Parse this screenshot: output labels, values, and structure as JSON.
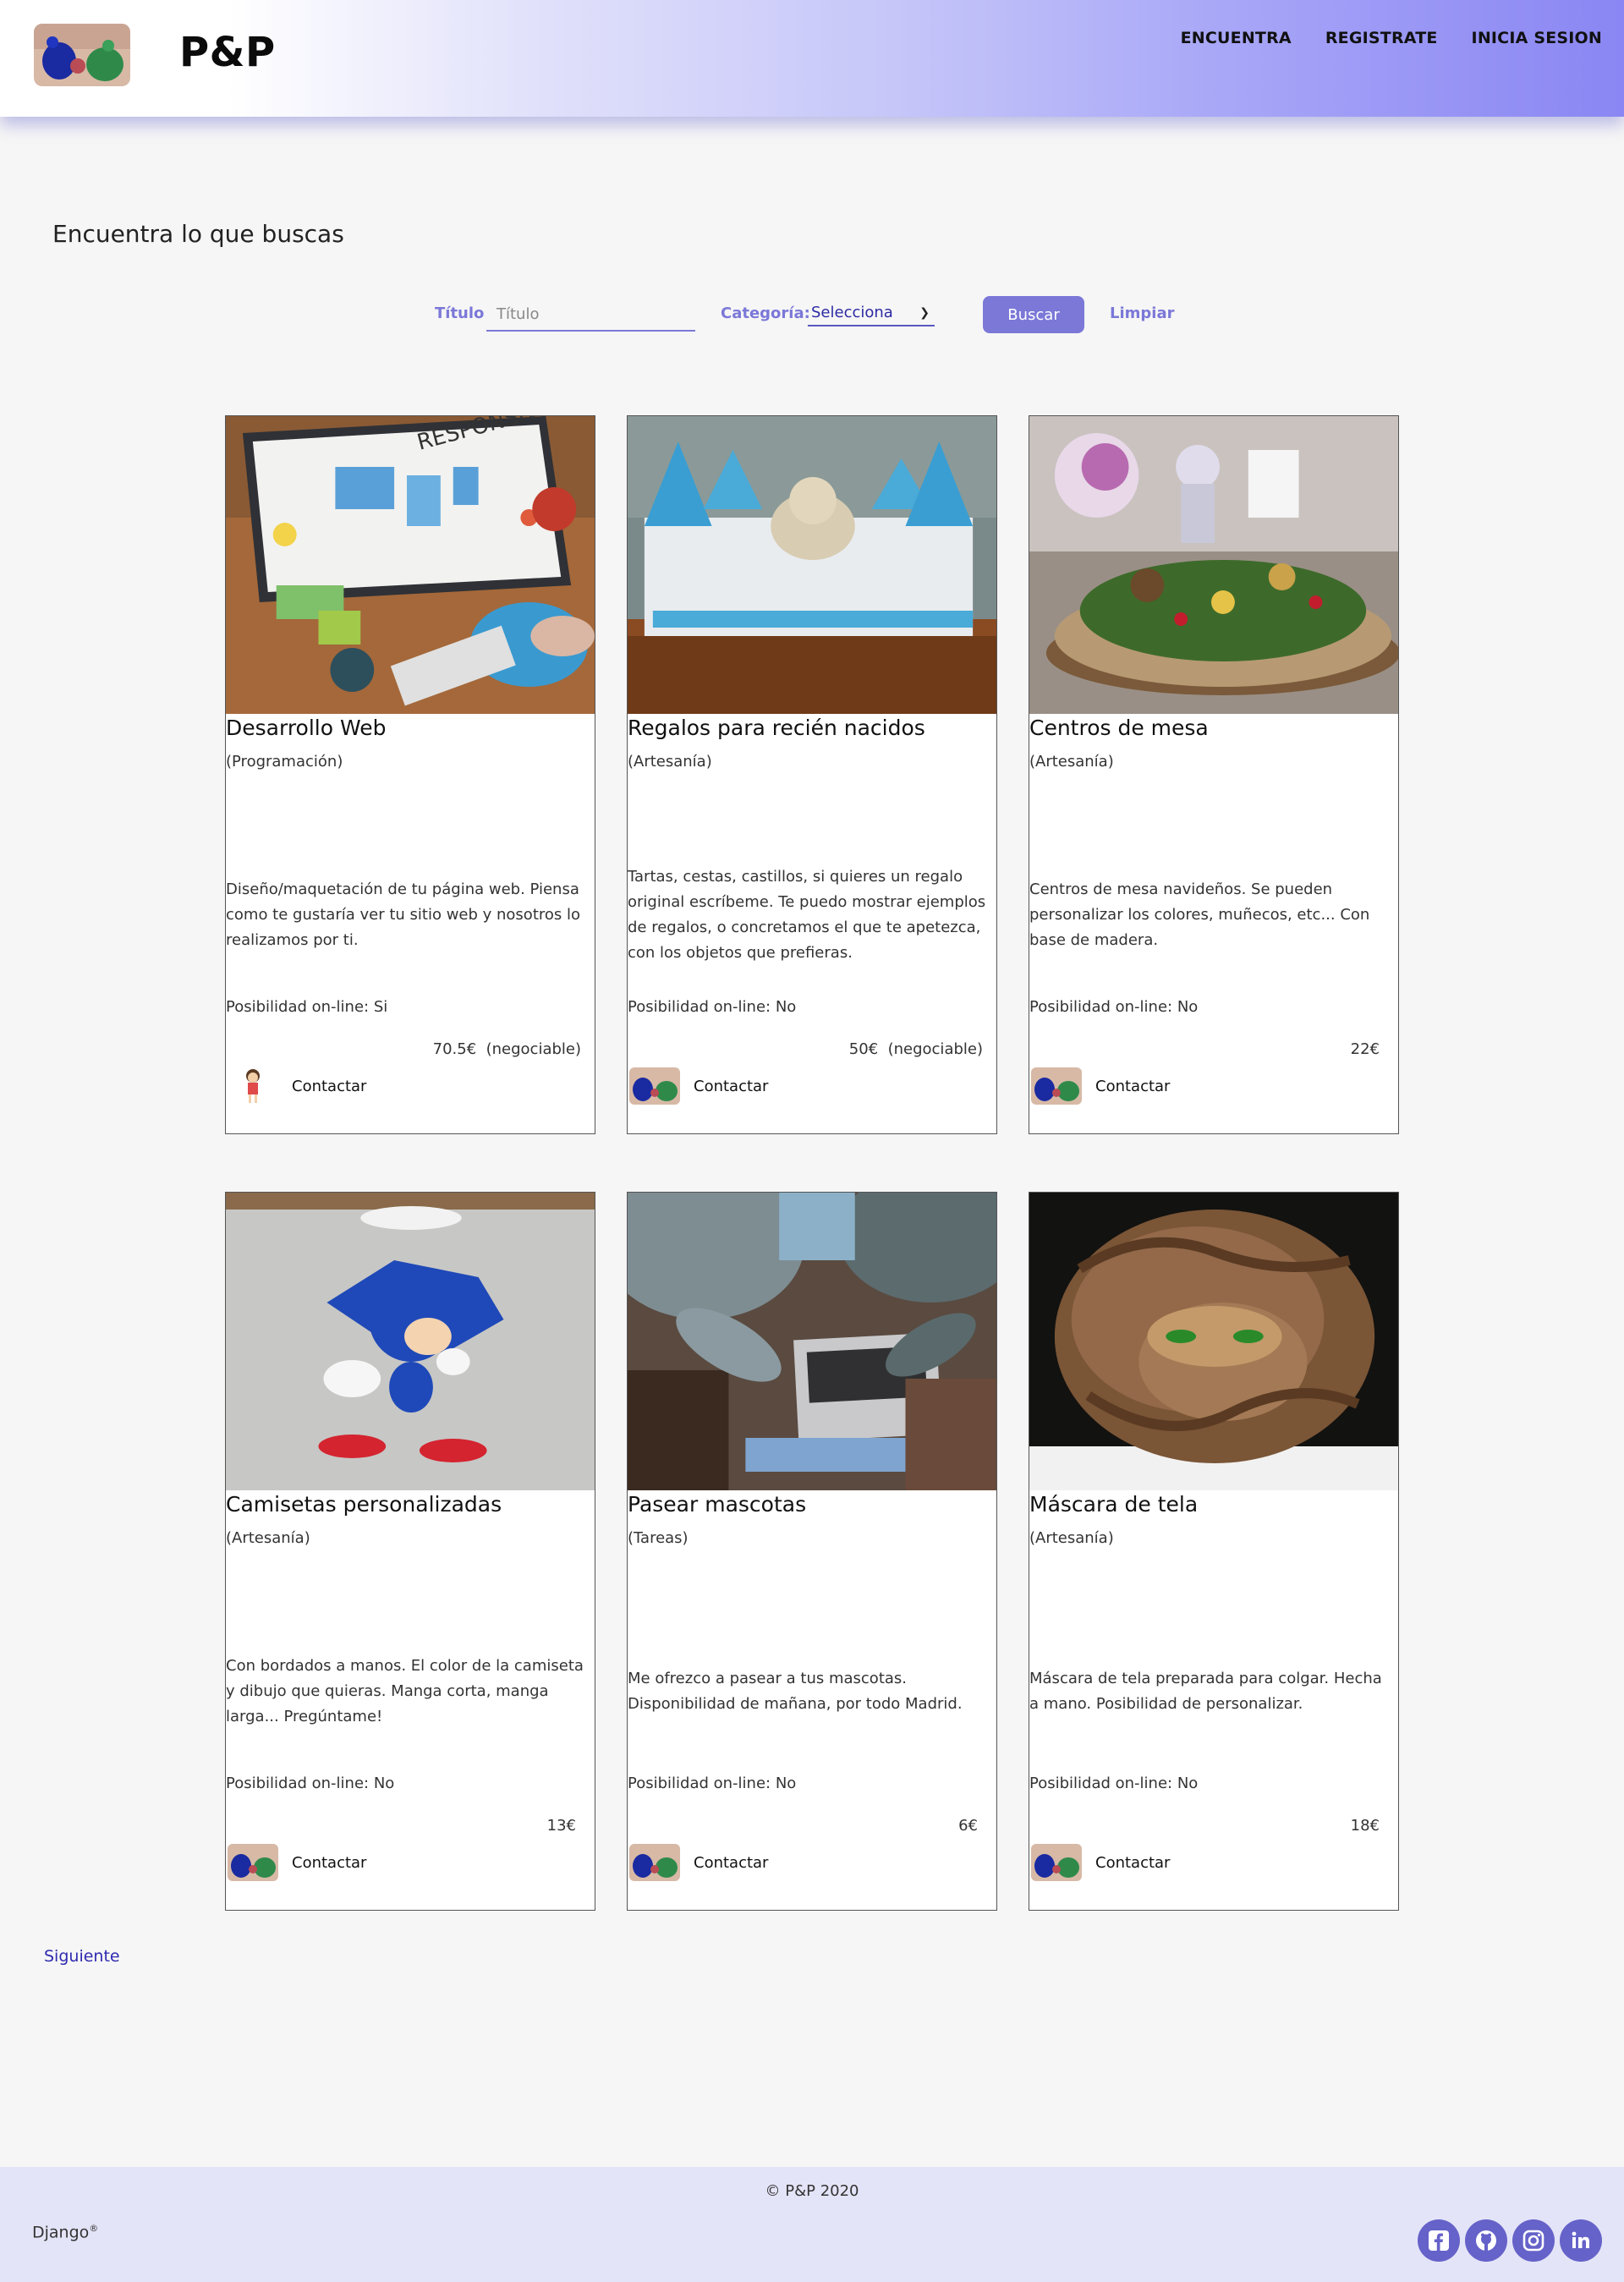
{
  "header": {
    "logo_alt": "P&P logo",
    "brand": "P&P",
    "nav": [
      "ENCUENTRA",
      "REGISTRATE",
      "INICIA SESION"
    ]
  },
  "page_title": "Encuentra lo que buscas",
  "filters": {
    "title_label": "Título",
    "title_placeholder": "Título",
    "category_label": "Categoría:",
    "category_selected": "Selecciona",
    "search_button": "Buscar",
    "clear_link": "Limpiar"
  },
  "cards": [
    {
      "title": "Desarrollo Web",
      "category": "(Programación)",
      "description": "Diseño/maquetación de tu página web. Piensa como te gustaría ver tu sitio web y nosotros lo realizamos por ti.",
      "online": "Posibilidad on-line: Si",
      "price": "70.5€  (negociable)",
      "contact": "Contactar",
      "image_icon": "responsive-design-desk-image",
      "avatar_icon": "girl-avatar-icon"
    },
    {
      "title": "Regalos para recién nacidos",
      "category": "(Artesanía)",
      "description": "Tartas, cestas, castillos, si quieres un regalo original escríbeme. Te puedo mostrar ejemplos de regalos, o concretamos el que te apetezca, con los objetos que prefieras.",
      "online": "Posibilidad on-line: No",
      "price": "50€  (negociable)",
      "contact": "Contactar",
      "image_icon": "diaper-castle-image",
      "avatar_icon": "dolls-avatar-icon"
    },
    {
      "title": "Centros de mesa",
      "category": "(Artesanía)",
      "description": "Centros de mesa navideños. Se pueden personalizar los colores, muñecos, etc... Con base de madera.",
      "online": "Posibilidad on-line: No",
      "price": "22€",
      "contact": "Contactar",
      "image_icon": "christmas-centerpiece-image",
      "avatar_icon": "dolls-avatar-icon"
    },
    {
      "title": "Camisetas personalizadas",
      "category": "(Artesanía)",
      "description": "Con bordados a manos. El color de la camiseta y dibujo que quieras. Manga corta, manga larga... Pregúntame!",
      "online": "Posibilidad on-line: No",
      "price": "13€",
      "contact": "Contactar",
      "image_icon": "sonic-shirt-image",
      "avatar_icon": "dolls-avatar-icon"
    },
    {
      "title": "Pasear mascotas",
      "category": "(Tareas)",
      "description": "Me ofrezco a pasear a tus mascotas. Disponibilidad de mañana, por todo Madrid.",
      "online": "Posibilidad on-line: No",
      "price": "6€",
      "contact": "Contactar",
      "image_icon": "laptop-people-image",
      "avatar_icon": "dolls-avatar-icon"
    },
    {
      "title": "Máscara de tela",
      "category": "(Artesanía)",
      "description": "Máscara de tela preparada para colgar. Hecha a mano. Posibilidad de personalizar.",
      "online": "Posibilidad on-line: No",
      "price": "18€",
      "contact": "Contactar",
      "image_icon": "fabric-mask-image",
      "avatar_icon": "dolls-avatar-icon"
    }
  ],
  "pagination": {
    "next": "Siguiente"
  },
  "footer": {
    "copyright": "© P&P 2020",
    "django": "Django",
    "django_mark": "®",
    "socials": [
      "facebook-icon",
      "github-icon",
      "instagram-icon",
      "linkedin-icon"
    ]
  },
  "colors": {
    "accent": "#7b78d8",
    "link": "#2f2ab0",
    "footer_bg": "#e4e4f8",
    "social_bg": "#6562c9"
  }
}
